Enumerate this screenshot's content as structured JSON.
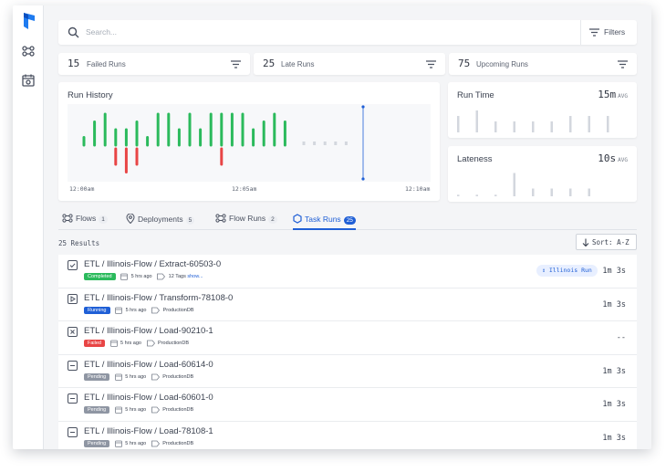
{
  "search": {
    "placeholder": "Search...",
    "filters_label": "Filters"
  },
  "stats": [
    {
      "count": "15",
      "label": "Failed Runs"
    },
    {
      "count": "25",
      "label": "Late Runs"
    },
    {
      "count": "75",
      "label": "Upcoming Runs"
    }
  ],
  "run_history": {
    "title": "Run History",
    "ticks": [
      "12:00am",
      "12:05am",
      "12:10am"
    ]
  },
  "run_time": {
    "title": "Run Time",
    "avg": "15m",
    "avg_unit": "AVG"
  },
  "lateness": {
    "title": "Lateness",
    "avg": "10s",
    "avg_unit": "AVG"
  },
  "tabs": [
    {
      "label": "Flows",
      "count": "1",
      "icon": "flow-icon"
    },
    {
      "label": "Deployments",
      "count": "5",
      "icon": "location-pin-icon"
    },
    {
      "label": "Flow Runs",
      "count": "2",
      "icon": "flow-runs-icon"
    },
    {
      "label": "Task Runs",
      "count": "25",
      "icon": "task-runs-icon",
      "active": true
    }
  ],
  "results": {
    "count_label": "25 Results",
    "sort_label": "Sort: A-Z"
  },
  "runs": [
    {
      "name": "ETL / Illinois-Flow / Extract-60503-0",
      "state": "Completed",
      "time": "5 hrs ago",
      "tags": "12 Tags",
      "tags_link": "show...",
      "chip": "Illinois Run",
      "duration": "1m 3s"
    },
    {
      "name": "ETL / Illinois-Flow / Transform-78108-0",
      "state": "Running",
      "time": "5 hrs ago",
      "tags": "ProductionDB",
      "duration": "1m 3s"
    },
    {
      "name": "ETL / Illinois-Flow / Load-90210-1",
      "state": "Failed",
      "time": "5 hrs ago",
      "tags": "ProductionDB",
      "duration": "--"
    },
    {
      "name": "ETL / Illinois-Flow / Load-60614-0",
      "state": "Pending",
      "time": "5 hrs ago",
      "tags": "ProductionDB",
      "duration": "1m 3s"
    },
    {
      "name": "ETL / Illinois-Flow / Load-60601-0",
      "state": "Pending",
      "time": "5 hrs ago",
      "tags": "ProductionDB",
      "duration": "1m 3s"
    },
    {
      "name": "ETL / Illinois-Flow / Load-78108-1",
      "state": "Pending",
      "time": "5 hrs ago",
      "tags": "ProductionDB",
      "duration": "1m 3s"
    }
  ],
  "colors": {
    "accent": "#1f5fd6",
    "completed": "#2bba5c",
    "failed": "#e84545",
    "running": "#1f5fd6",
    "pending": "#8f96a3",
    "scheduled": "#d3d7de"
  },
  "chart_data": [
    {
      "type": "bar",
      "title": "Run History",
      "ylabel": "",
      "xlabel": "",
      "series": [
        {
          "values": [
            1,
            3,
            4,
            2,
            2,
            3,
            1,
            4,
            4,
            2,
            4,
            2,
            4,
            4,
            4,
            4,
            2,
            3,
            4,
            3
          ]
        },
        {
          "values": [
            0,
            0,
            0,
            2,
            3,
            2,
            0,
            0,
            0,
            0,
            0,
            0,
            0,
            2,
            0,
            0,
            0,
            0,
            0,
            0
          ]
        },
        {
          "values": [
            0,
            0,
            0,
            0,
            0,
            0,
            0,
            0,
            0,
            0,
            0,
            0,
            0,
            0,
            0,
            0,
            0,
            0,
            0,
            0,
            1,
            1,
            1,
            1,
            1
          ]
        }
      ]
    },
    {
      "type": "bar",
      "title": "Run Time",
      "values": [
        3,
        4,
        2,
        2,
        2,
        2,
        3,
        3,
        3
      ]
    },
    {
      "type": "bar",
      "title": "Lateness",
      "values": [
        0.2,
        0.2,
        0.2,
        3,
        1,
        1,
        1,
        1
      ]
    }
  ]
}
